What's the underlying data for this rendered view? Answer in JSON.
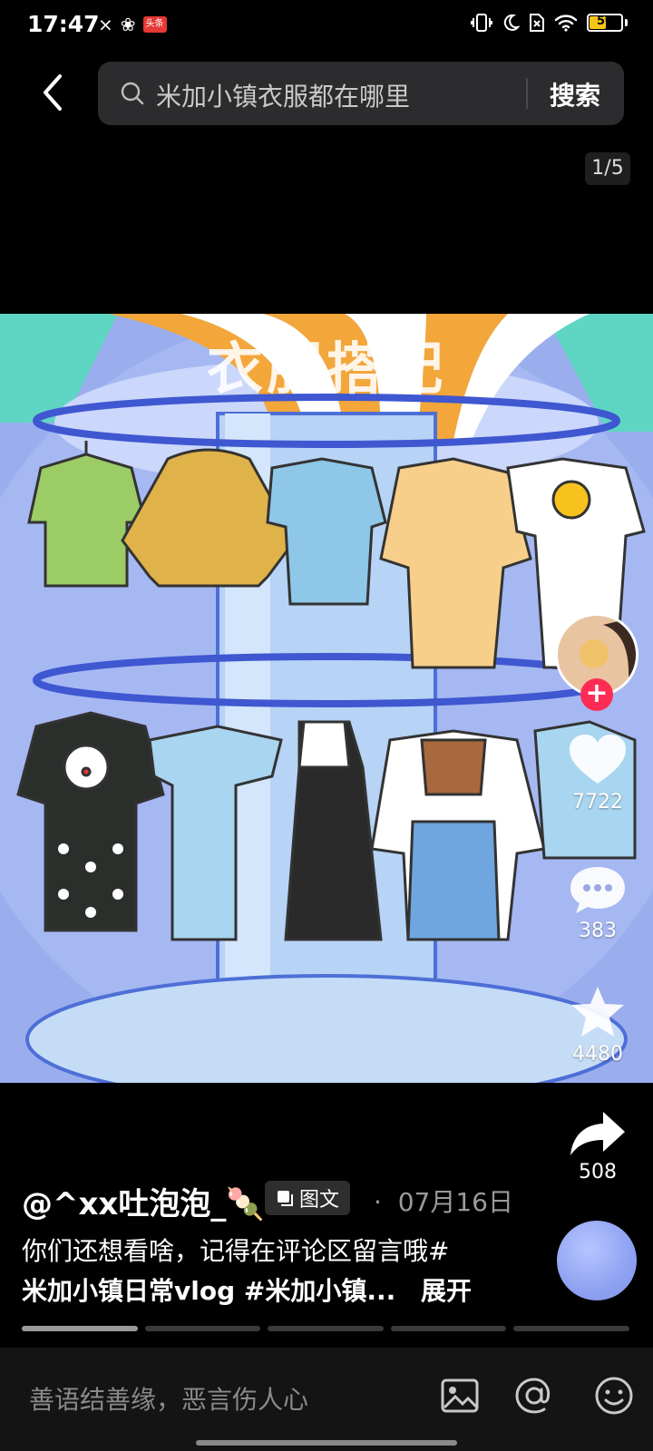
{
  "status_bar": {
    "time": "17:47",
    "left_icons": [
      "link-icon",
      "app-icon",
      "news-badge-icon"
    ],
    "news_badge": "头条",
    "right_icons": [
      "vibrate-icon",
      "moon-icon",
      "no-sim-icon",
      "wifi-icon",
      "battery-icon"
    ],
    "battery_level": "50"
  },
  "header": {
    "search_query": "米加小镇衣服都在哪里",
    "search_button": "搜索",
    "page_indicator": "1/5"
  },
  "post": {
    "image_title": "衣服搭配",
    "author": "@^xx吐泡泡_",
    "author_emoji": "🍡",
    "type_tag": "图文",
    "date_separator": "·",
    "date": "07月16日",
    "description_line1": "你们还想看啥，记得在评论区留言哦#",
    "description_line2": "米加小镇日常vlog #米加小镇...",
    "expand_label": "展开",
    "image_count": 5,
    "current_image": 1
  },
  "actions": {
    "follow_label": "+",
    "likes": "7722",
    "comments": "383",
    "favorites": "4480",
    "shares": "508"
  },
  "comment_bar": {
    "placeholder": "善语结善缘，恶言伤人心"
  },
  "colors": {
    "follow_red": "#fe2c55",
    "stripe_orange": "#f3a63a",
    "background_blue": "#98abee"
  }
}
